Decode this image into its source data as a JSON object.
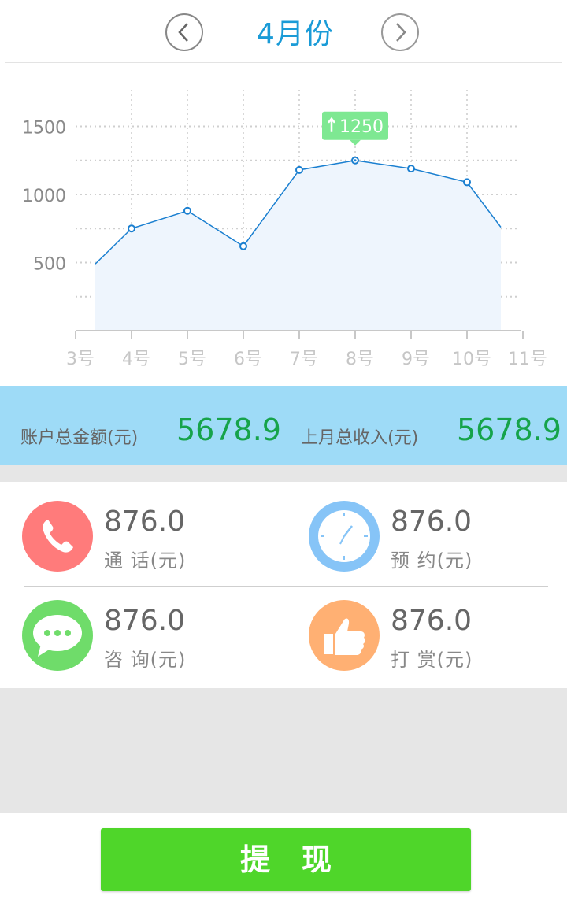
{
  "header": {
    "month_title": "4月份",
    "prev_icon": "chevron-left-icon",
    "next_icon": "chevron-right-icon"
  },
  "chart_data": {
    "type": "line",
    "x": [
      "3号",
      "4号",
      "5号",
      "6号",
      "7号",
      "8号",
      "9号",
      "10号",
      "11号"
    ],
    "y_ticks": [
      500,
      1000,
      1500
    ],
    "ylim": [
      0,
      1650
    ],
    "series": [
      {
        "values": [
          490,
          750,
          880,
          620,
          1180,
          1250,
          1190,
          1090,
          760
        ],
        "markers_shown": [
          false,
          true,
          true,
          true,
          true,
          true,
          true,
          true,
          false
        ]
      }
    ],
    "highlight": {
      "index": 5,
      "label": "1250",
      "arrow": "up-arrow-icon"
    },
    "grid": true,
    "colors": {
      "line": "#1a7fd0",
      "fill": "#eef5fd",
      "tooltip": "#7ee892"
    }
  },
  "summary": {
    "account_total_label": "账户总金额(元)",
    "account_total_value": "5678.9",
    "last_month_label": "上月总收入(元)",
    "last_month_value": "5678.9"
  },
  "stats": {
    "call": {
      "value": "876.0",
      "label": "通 话(元)",
      "icon": "phone-icon",
      "color": "#ff7b7b"
    },
    "appointment": {
      "value": "876.0",
      "label": "预 约(元)",
      "icon": "clock-icon",
      "color": "#86c4f7"
    },
    "consult": {
      "value": "876.0",
      "label": "咨 询(元)",
      "icon": "chat-bubble-icon",
      "color": "#6fdc6a"
    },
    "reward": {
      "value": "876.0",
      "label": "打 赏(元)",
      "icon": "thumbs-up-icon",
      "color": "#ffb073"
    }
  },
  "footer": {
    "withdraw_label": "提现",
    "button_color": "#4fd62a"
  }
}
